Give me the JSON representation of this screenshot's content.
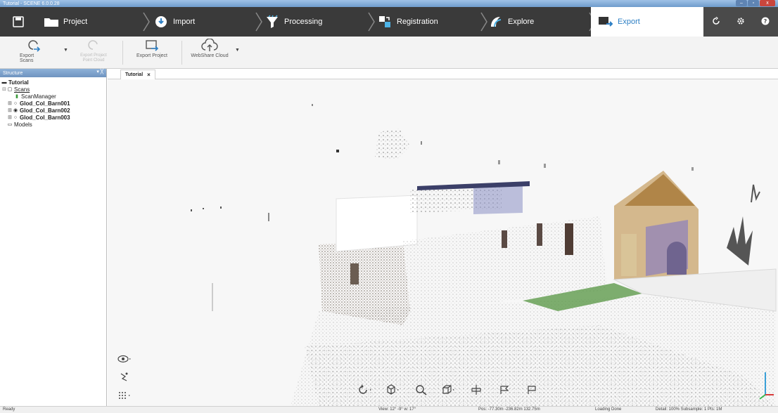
{
  "window": {
    "title": "Tutorial - SCENE 6.0.0.28",
    "min": "–",
    "max": "▫",
    "close": "x"
  },
  "workflow": {
    "tabs": [
      {
        "label": "Project"
      },
      {
        "label": "Import"
      },
      {
        "label": "Processing"
      },
      {
        "label": "Registration"
      },
      {
        "label": "Explore"
      },
      {
        "label": "Export"
      }
    ],
    "accent": "#2d7fc4"
  },
  "ribbon": {
    "export_scans": "Export Scans",
    "export_project_point_cloud": "Export Project\nPoint Cloud",
    "export_project": "Export Project",
    "webshare_cloud": "WebShare Cloud"
  },
  "structure": {
    "header": "Structure",
    "tree": {
      "root": "Tutorial",
      "scans": "Scans",
      "scan_manager": "ScanManager",
      "scan1": "Glod_Col_Barn001",
      "scan2": "Glod_Col_Barn002",
      "scan3": "Glod_Col_Barn003",
      "models": "Models"
    }
  },
  "view": {
    "tab_label": "Tutorial",
    "tab_close": "×"
  },
  "status": {
    "ready": "Ready",
    "view": "View: 12° -9° w: 17°",
    "pos": "Pos: -77.30m -236.82m 132.75m",
    "loading": "Loading Done",
    "detail": "Detail: 100%  Subsample: 1  Pts: 1M"
  }
}
